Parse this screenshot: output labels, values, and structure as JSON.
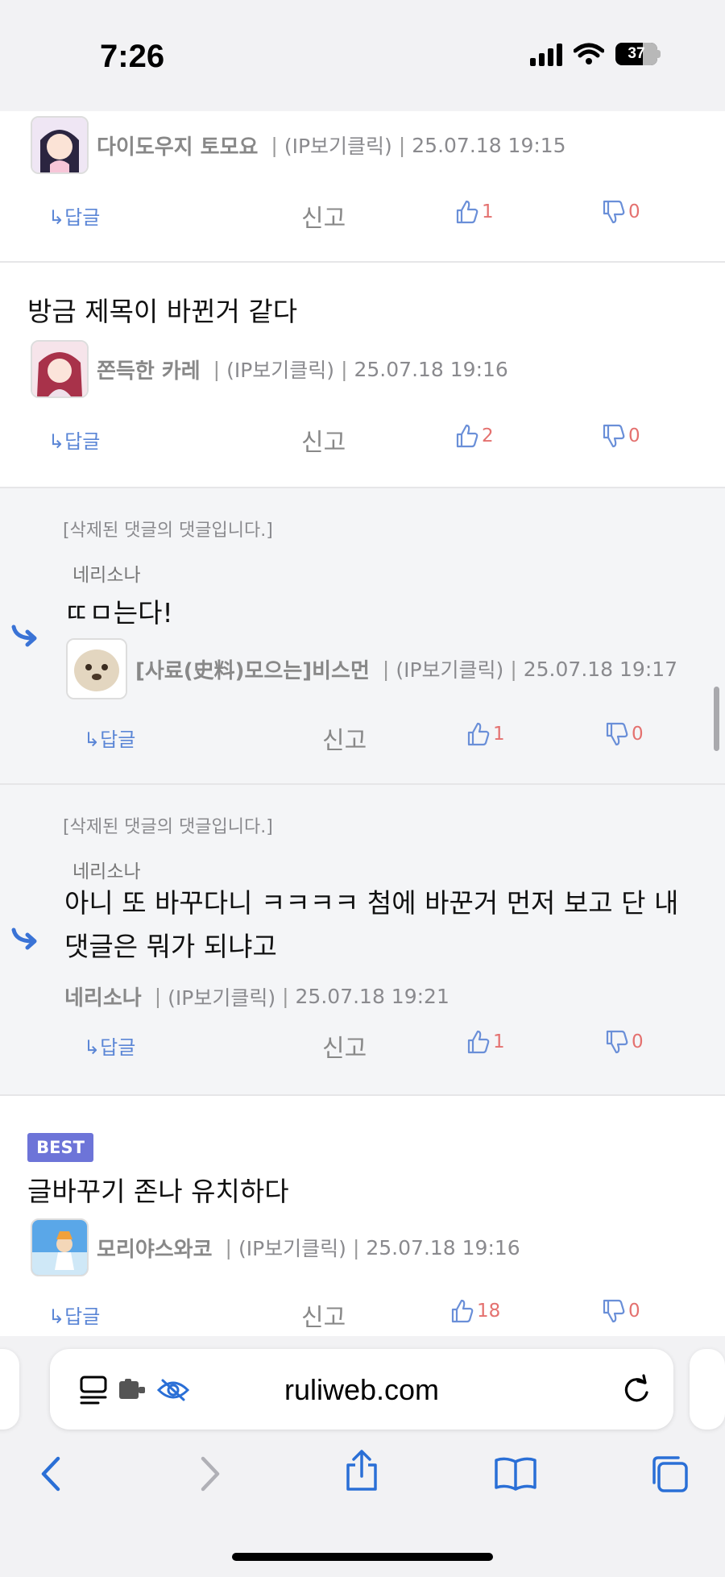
{
  "status_bar": {
    "time": "7:26",
    "battery": "37"
  },
  "comments": [
    {
      "nickname": "다이도우지 토모요",
      "ip_label": "(IP보기클릭)",
      "timestamp": "25.07.18 19:15",
      "reply_label": "답글",
      "report_label": "신고",
      "likes": "1",
      "dislikes": "0"
    },
    {
      "text": "방금 제목이 바뀐거 같다",
      "nickname": "쫀득한 카레",
      "ip_label": "(IP보기클릭)",
      "timestamp": "25.07.18 19:16",
      "reply_label": "답글",
      "report_label": "신고",
      "likes": "2",
      "dislikes": "0"
    },
    {
      "deleted_note": "[삭제된 댓글의 댓글입니다.]",
      "parent_nickname": "네리소나",
      "text": "ㄸㅁ는다!",
      "nickname": "[사료(史料)모으는]비스먼",
      "ip_label": "(IP보기클릭)",
      "timestamp": "25.07.18 19:17",
      "reply_label": "답글",
      "report_label": "신고",
      "likes": "1",
      "dislikes": "0"
    },
    {
      "deleted_note": "[삭제된 댓글의 댓글입니다.]",
      "parent_nickname": "네리소나",
      "text": "아니 또 바꾸다니 ㅋㅋㅋㅋ 첨에 바꾼거 먼저 보고 단 내 댓글은 뭐가 되냐고",
      "nickname": "네리소나",
      "ip_label": "(IP보기클릭)",
      "timestamp": "25.07.18 19:21",
      "reply_label": "답글",
      "report_label": "신고",
      "likes": "1",
      "dislikes": "0"
    },
    {
      "badge": "BEST",
      "text": "글바꾸기 존나 유치하다",
      "nickname": "모리야스와코",
      "ip_label": "(IP보기클릭)",
      "timestamp": "25.07.18 19:16",
      "reply_label": "답글",
      "report_label": "신고",
      "likes": "18",
      "dislikes": "0"
    }
  ],
  "browser": {
    "url": "ruliweb.com"
  },
  "colors": {
    "accent": "#5b86d6",
    "count": "#e4716f",
    "badge": "#6d74d8"
  }
}
